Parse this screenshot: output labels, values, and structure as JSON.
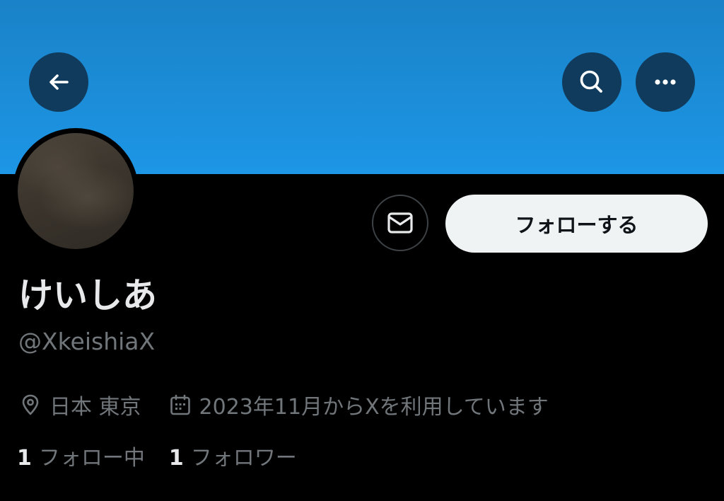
{
  "header": {
    "banner_color": "#1d96e6",
    "back_icon": "arrow-left-icon",
    "search_icon": "search-icon",
    "more_icon": "more-horizontal-icon"
  },
  "profile": {
    "display_name": "けいしあ",
    "handle": "@XkeishiaX",
    "location": "日本 東京",
    "joined": "2023年11月からXを利用しています",
    "location_icon": "location-pin-icon",
    "joined_icon": "calendar-icon"
  },
  "actions": {
    "message_icon": "envelope-icon",
    "follow_label": "フォローする"
  },
  "stats": {
    "following_count": "1",
    "following_label": "フォロー中",
    "followers_count": "1",
    "followers_label": "フォロワー"
  }
}
